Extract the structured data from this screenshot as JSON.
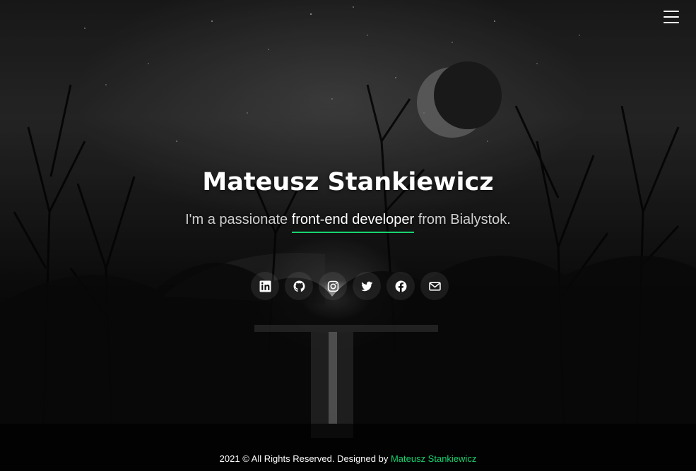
{
  "header": {
    "menu_icon": "hamburger-menu-icon"
  },
  "hero": {
    "name": "Mateusz Stankiewicz",
    "tagline_prefix": "I'm a passionate ",
    "tagline_typed": "front-end developer",
    "tagline_suffix": " from Bialystok."
  },
  "socials": [
    {
      "icon": "linkedin-icon"
    },
    {
      "icon": "github-icon"
    },
    {
      "icon": "instagram-icon"
    },
    {
      "icon": "twitter-icon"
    },
    {
      "icon": "facebook-icon"
    },
    {
      "icon": "mail-icon"
    }
  ],
  "footer": {
    "text": "2021 © All Rights Reserved. Designed by ",
    "author": "Mateusz Stankiewicz"
  },
  "colors": {
    "accent": "#18d26e",
    "background": "#000000",
    "text": "#ffffff"
  }
}
